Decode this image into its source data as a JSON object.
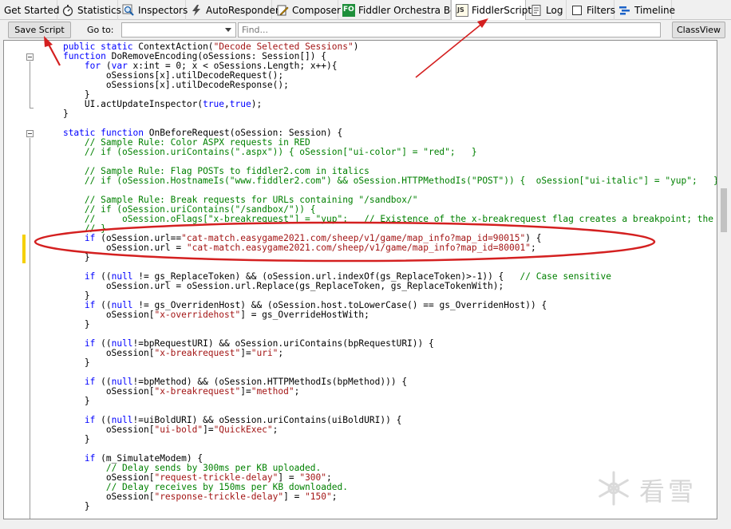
{
  "tabs": [
    {
      "label": "Get Started",
      "icon": "none"
    },
    {
      "label": "Statistics",
      "icon": "stopwatch-icon"
    },
    {
      "label": "Inspectors",
      "icon": "magnifier-icon"
    },
    {
      "label": "AutoResponder",
      "icon": "lightning-icon"
    },
    {
      "label": "Composer",
      "icon": "pencil-icon"
    },
    {
      "label": "Fiddler Orchestra Beta",
      "icon": "fo-icon",
      "icon_text": "FO"
    },
    {
      "label": "FiddlerScript",
      "icon": "script-icon",
      "icon_text": "JS",
      "active": true
    },
    {
      "label": "Log",
      "icon": "log-icon"
    },
    {
      "label": "Filters",
      "icon": "checkbox-icon"
    },
    {
      "label": "Timeline",
      "icon": "timeline-icon"
    }
  ],
  "toolbar": {
    "save_label": "Save Script",
    "goto_label": "Go to:",
    "goto_value": "",
    "find_placeholder": "Find...",
    "classview_label": "ClassView"
  },
  "code_lines": [
    [
      [
        "",
        "    "
      ],
      [
        "kw",
        "public static"
      ],
      [
        "",
        " ContextAction("
      ],
      [
        "str",
        "\"Decode Selected Sessions\""
      ],
      [
        "",
        ")"
      ]
    ],
    [
      [
        "",
        "    "
      ],
      [
        "kw",
        "function"
      ],
      [
        "",
        " DoRemoveEncoding(oSessions: Session[]) {"
      ]
    ],
    [
      [
        "",
        "        "
      ],
      [
        "kw",
        "for"
      ],
      [
        "",
        " ("
      ],
      [
        "kw",
        "var"
      ],
      [
        "",
        " x:int = 0; x < oSessions.Length; x++){"
      ]
    ],
    [
      [
        "",
        "            oSessions[x].utilDecodeRequest();"
      ]
    ],
    [
      [
        "",
        "            oSessions[x].utilDecodeResponse();"
      ]
    ],
    [
      [
        "",
        "        }"
      ]
    ],
    [
      [
        "",
        "        UI.actUpdateInspector("
      ],
      [
        "kw",
        "true"
      ],
      [
        "",
        ","
      ],
      [
        "kw",
        "true"
      ],
      [
        "",
        ");"
      ]
    ],
    [
      [
        "",
        "    }"
      ]
    ],
    [
      [
        "",
        ""
      ]
    ],
    [
      [
        "",
        "    "
      ],
      [
        "kw",
        "static function"
      ],
      [
        "",
        " OnBeforeRequest(oSession: Session) {"
      ]
    ],
    [
      [
        "",
        "        "
      ],
      [
        "cm",
        "// Sample Rule: Color ASPX requests in RED"
      ]
    ],
    [
      [
        "",
        "        "
      ],
      [
        "cm",
        "// if (oSession.uriContains(\".aspx\")) { oSession[\"ui-color\"] = \"red\";   }"
      ]
    ],
    [
      [
        "",
        ""
      ]
    ],
    [
      [
        "",
        "        "
      ],
      [
        "cm",
        "// Sample Rule: Flag POSTs to fiddler2.com in italics"
      ]
    ],
    [
      [
        "",
        "        "
      ],
      [
        "cm",
        "// if (oSession.HostnameIs(\"www.fiddler2.com\") && oSession.HTTPMethodIs(\"POST\")) {  oSession[\"ui-italic\"] = \"yup\";   }"
      ]
    ],
    [
      [
        "",
        ""
      ]
    ],
    [
      [
        "",
        "        "
      ],
      [
        "cm",
        "// Sample Rule: Break requests for URLs containing \"/sandbox/\""
      ]
    ],
    [
      [
        "",
        "        "
      ],
      [
        "cm",
        "// if (oSession.uriContains(\"/sandbox/\")) {"
      ]
    ],
    [
      [
        "",
        "        "
      ],
      [
        "cm",
        "//     oSession.oFlags[\"x-breakrequest\"] = \"yup\";   // Existence of the x-breakrequest flag creates a breakpoint; the \"yup\" value is unimportant."
      ]
    ],
    [
      [
        "",
        "        "
      ],
      [
        "cm",
        "// }"
      ]
    ],
    [
      [
        "",
        "        "
      ],
      [
        "kw",
        "if"
      ],
      [
        "",
        " (oSession.url=="
      ],
      [
        "str",
        "\"cat-match.easygame2021.com/sheep/v1/game/map_info?map_id=90015\""
      ],
      [
        "",
        ") {"
      ]
    ],
    [
      [
        "",
        "            oSession.url = "
      ],
      [
        "str",
        "\"cat-match.easygame2021.com/sheep/v1/game/map_info?map_id=80001\""
      ],
      [
        "",
        ";"
      ]
    ],
    [
      [
        "",
        "        }"
      ]
    ],
    [
      [
        "",
        ""
      ]
    ],
    [
      [
        "",
        "        "
      ],
      [
        "kw",
        "if"
      ],
      [
        "",
        " (("
      ],
      [
        "kw",
        "null"
      ],
      [
        "",
        " != gs_ReplaceToken) && (oSession.url.indexOf(gs_ReplaceToken)>-1)) {   "
      ],
      [
        "cm",
        "// Case sensitive"
      ]
    ],
    [
      [
        "",
        "            oSession.url = oSession.url.Replace(gs_ReplaceToken, gs_ReplaceTokenWith);"
      ]
    ],
    [
      [
        "",
        "        }"
      ]
    ],
    [
      [
        "",
        "        "
      ],
      [
        "kw",
        "if"
      ],
      [
        "",
        " (("
      ],
      [
        "kw",
        "null"
      ],
      [
        "",
        " != gs_OverridenHost) && (oSession.host.toLowerCase() == gs_OverridenHost)) {"
      ]
    ],
    [
      [
        "",
        "            oSession["
      ],
      [
        "str",
        "\"x-overridehost\""
      ],
      [
        "",
        "] = gs_OverrideHostWith;"
      ]
    ],
    [
      [
        "",
        "        }"
      ]
    ],
    [
      [
        "",
        ""
      ]
    ],
    [
      [
        "",
        "        "
      ],
      [
        "kw",
        "if"
      ],
      [
        "",
        " (("
      ],
      [
        "kw",
        "null"
      ],
      [
        "",
        "!=bpRequestURI) && oSession.uriContains(bpRequestURI)) {"
      ]
    ],
    [
      [
        "",
        "            oSession["
      ],
      [
        "str",
        "\"x-breakrequest\""
      ],
      [
        "",
        "]="
      ],
      [
        "str",
        "\"uri\""
      ],
      [
        "",
        ";"
      ]
    ],
    [
      [
        "",
        "        }"
      ]
    ],
    [
      [
        "",
        ""
      ]
    ],
    [
      [
        "",
        "        "
      ],
      [
        "kw",
        "if"
      ],
      [
        "",
        " (("
      ],
      [
        "kw",
        "null"
      ],
      [
        "",
        "!=bpMethod) && (oSession.HTTPMethodIs(bpMethod))) {"
      ]
    ],
    [
      [
        "",
        "            oSession["
      ],
      [
        "str",
        "\"x-breakrequest\""
      ],
      [
        "",
        "]="
      ],
      [
        "str",
        "\"method\""
      ],
      [
        "",
        ";"
      ]
    ],
    [
      [
        "",
        "        }"
      ]
    ],
    [
      [
        "",
        ""
      ]
    ],
    [
      [
        "",
        "        "
      ],
      [
        "kw",
        "if"
      ],
      [
        "",
        " (("
      ],
      [
        "kw",
        "null"
      ],
      [
        "",
        "!=uiBoldURI) && oSession.uriContains(uiBoldURI)) {"
      ]
    ],
    [
      [
        "",
        "            oSession["
      ],
      [
        "str",
        "\"ui-bold\""
      ],
      [
        "",
        "]="
      ],
      [
        "str",
        "\"QuickExec\""
      ],
      [
        "",
        ";"
      ]
    ],
    [
      [
        "",
        "        }"
      ]
    ],
    [
      [
        "",
        ""
      ]
    ],
    [
      [
        "",
        "        "
      ],
      [
        "kw",
        "if"
      ],
      [
        "",
        " (m_SimulateModem) {"
      ]
    ],
    [
      [
        "",
        "            "
      ],
      [
        "cm",
        "// Delay sends by 300ms per KB uploaded."
      ]
    ],
    [
      [
        "",
        "            oSession["
      ],
      [
        "str",
        "\"request-trickle-delay\""
      ],
      [
        "",
        "] = "
      ],
      [
        "str",
        "\"300\""
      ],
      [
        "",
        ";"
      ]
    ],
    [
      [
        "",
        "            "
      ],
      [
        "cm",
        "// Delay receives by 150ms per KB downloaded."
      ]
    ],
    [
      [
        "",
        "            oSession["
      ],
      [
        "str",
        "\"response-trickle-delay\""
      ],
      [
        "",
        "] = "
      ],
      [
        "str",
        "\"150\""
      ],
      [
        "",
        ";"
      ]
    ],
    [
      [
        "",
        "        }"
      ]
    ]
  ],
  "watermark": {
    "text": "看雪",
    "icon": "snowflake-icon"
  },
  "colors": {
    "keyword": "#0000ff",
    "string": "#a31515",
    "comment": "#008000",
    "annotation": "#d42020",
    "change_marker": "#f5d000"
  }
}
